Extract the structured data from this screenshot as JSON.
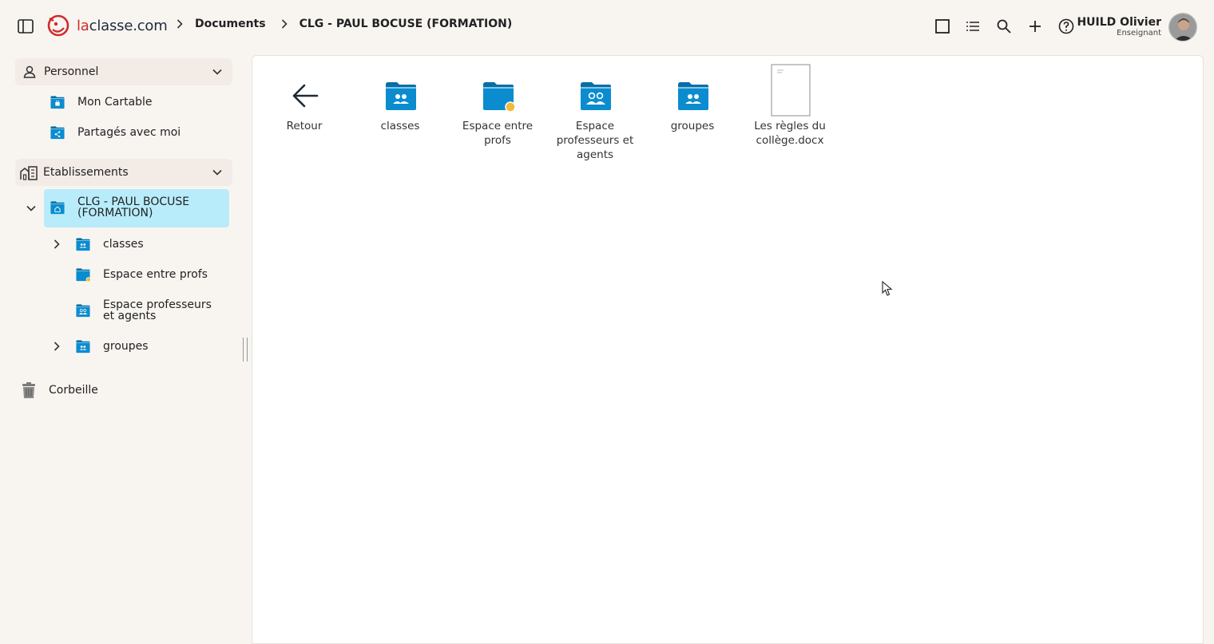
{
  "brand": {
    "logo_prefix": "la",
    "logo_suffix": "classe.com",
    "logo_color": "#d22a2a"
  },
  "breadcrumb": {
    "items": [
      "Documents",
      "CLG - PAUL BOCUSE (FORMATION)"
    ]
  },
  "toolbar": {
    "icons": [
      "square-view-icon",
      "list-view-icon",
      "search-icon",
      "plus-icon",
      "help-icon"
    ]
  },
  "user": {
    "name": "HUILD Olivier",
    "role": "Enseignant"
  },
  "sidebar": {
    "personnel": {
      "label": "Personnel",
      "items": [
        {
          "label": "Mon Cartable",
          "icon": "briefcase-folder-icon"
        },
        {
          "label": "Partagés avec moi",
          "icon": "shared-folder-icon"
        }
      ]
    },
    "etablissements": {
      "label": "Etablissements",
      "selected": {
        "label": "CLG - PAUL BOCUSE (FORMATION)",
        "icon": "school-folder-icon"
      },
      "children": [
        {
          "label": "classes",
          "icon": "group-folder-icon",
          "expandable": true
        },
        {
          "label": "Espace entre profs",
          "icon": "folder-dot-icon",
          "expandable": false
        },
        {
          "label": "Espace professeurs et agents",
          "icon": "people-folder-icon",
          "expandable": false
        },
        {
          "label": "groupes",
          "icon": "group-folder-icon",
          "expandable": true
        }
      ]
    },
    "trash": {
      "label": "Corbeille",
      "icon": "trash-icon"
    }
  },
  "main": {
    "tiles": [
      {
        "label": "Retour",
        "icon": "back-arrow-icon"
      },
      {
        "label": "classes",
        "icon": "group-folder-icon"
      },
      {
        "label": "Espace entre profs",
        "icon": "folder-dot-icon"
      },
      {
        "label": "Espace professeurs et agents",
        "icon": "people-folder-icon"
      },
      {
        "label": "groupes",
        "icon": "group-folder-icon"
      },
      {
        "label": "Les règles du collège.docx",
        "icon": "document-icon"
      }
    ]
  },
  "colors": {
    "folder": "#0b8ccf",
    "folder_tab": "#0a6ea7",
    "selected_bg": "#b8ecfb",
    "section_bg": "#f3ebe6",
    "dot": "#f2b93b"
  }
}
